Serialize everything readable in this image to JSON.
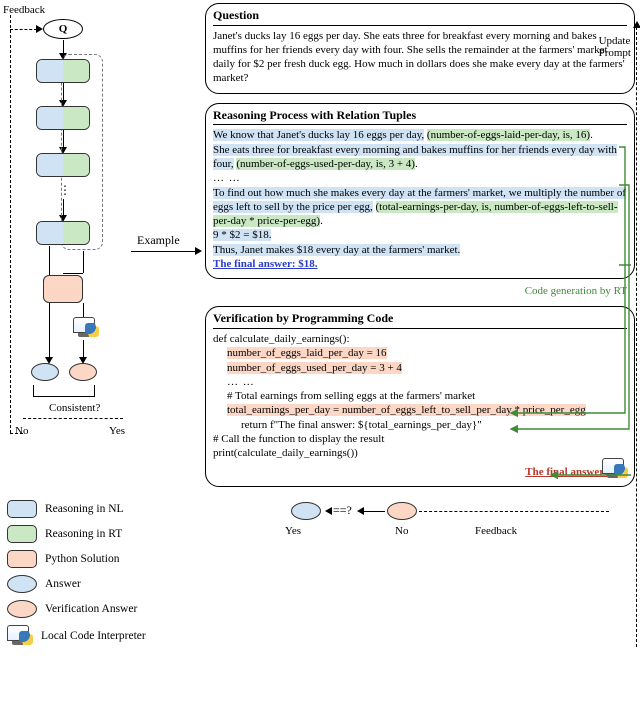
{
  "chart_data": null,
  "labels": {
    "feedback": "Feedback",
    "example": "Example",
    "consistent": "Consistent?",
    "no": "No",
    "yes": "Yes",
    "q": "Q",
    "update_prompt": "Update\nPrompt",
    "codegen": "Code generation by RT",
    "eq": "==?",
    "bottom_feedback": "Feedback"
  },
  "legend": {
    "nl": "Reasoning in NL",
    "rt": "Reasoning in RT",
    "py": "Python Solution",
    "ans": "Answer",
    "ver": "Verification Answer",
    "interp": "Local Code Interpreter"
  },
  "question": {
    "title": "Question",
    "body": "Janet's ducks lay 16 eggs per day. She eats three for breakfast every morning and bakes muffins for her friends every day with four. She sells the remainder at the farmers' market daily for $2 per fresh duck egg. How much in dollars does she make every day at the farmers' market?"
  },
  "reasoning": {
    "title": "Reasoning Process with Relation Tuples",
    "p1_nl": "We know that Janet's ducks lay 16 eggs per day,",
    "p1_rt": "(number-of-eggs-laid-per-day, is, 16)",
    "p2_nl": "She eats three for breakfast every morning and bakes muffins for her friends every day with four,",
    "p2_rt": "(number-of-eggs-used-per-day, is, 3 + 4)",
    "p3_nl": "To find out how much she makes every day at the farmers' market, we multiply the number of eggs left to sell by the price per egg,",
    "p3_rt": "(total-earnings-per-day, is, number-of-eggs-left-to-sell-per-day * price-per-egg)",
    "calc": "9 * $2 = $18.",
    "concl": "Thus, Janet makes $18 every day at the farmers' market.",
    "final": "The final answer: $18."
  },
  "verification": {
    "title": "Verification by Programming Code",
    "line1": "def calculate_daily_earnings():",
    "line2": "number_of_eggs_laid_per_day = 16",
    "line3": "number_of_eggs_used_per_day = 3 + 4",
    "line4": "… …",
    "line5": "# Total earnings from selling eggs at the farmers' market",
    "line6": "total_earnings_per_day = number_of_eggs_left_to_sell_per_day * price_per_egg",
    "line7": "return f\"The final answer: ${total_earnings_per_day}\"",
    "line8": "# Call the function to display the result",
    "line9": "print(calculate_daily_earnings())",
    "final": "The final answer: $18"
  }
}
